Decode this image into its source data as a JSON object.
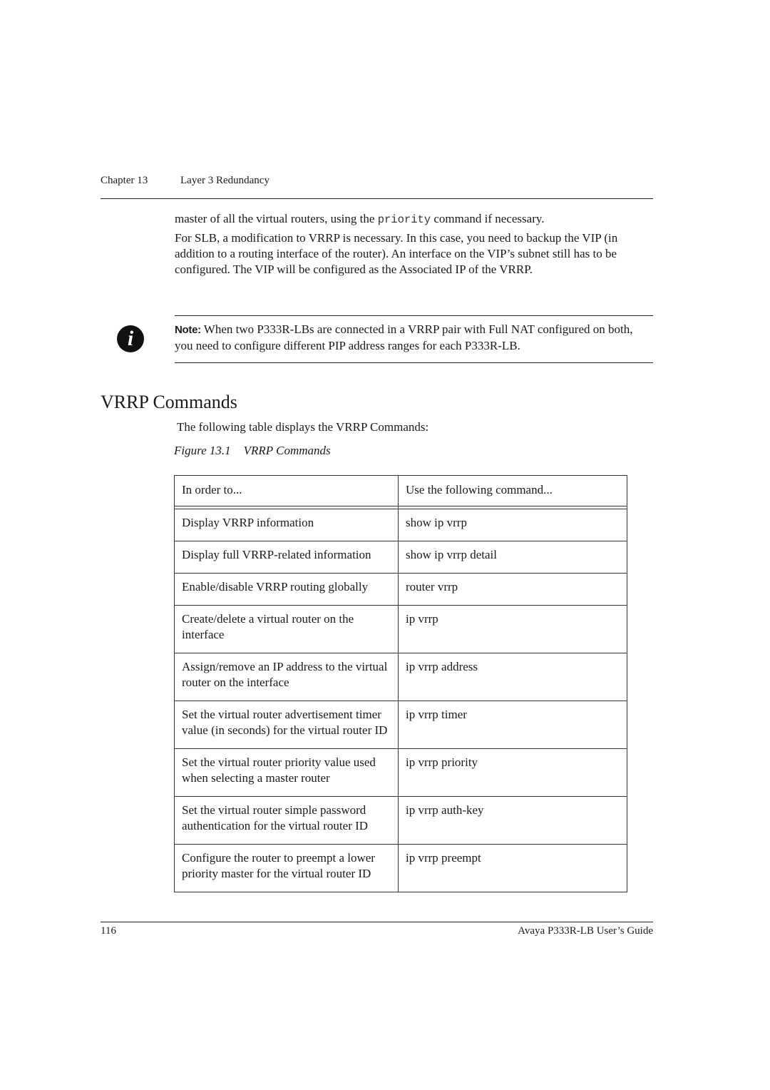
{
  "header": {
    "chapter": "Chapter 13",
    "title": "Layer 3 Redundancy"
  },
  "body": {
    "para1_before": "master of all the virtual routers, using the ",
    "para1_code": "priority",
    "para1_after": " command if necessary.",
    "para2": "For SLB, a modification to VRRP is necessary. In this case, you need to backup the VIP (in addition to a routing interface of the router). An interface on the VIP’s subnet still has to be configured. The VIP will be configured as the Associated IP of the VRRP."
  },
  "note": {
    "icon": "info-icon",
    "label": "Note:",
    "text": "When two P333R-LBs are connected in a VRRP pair with Full NAT configured on both, you need to configure different PIP address ranges for each P333R-LB."
  },
  "section": {
    "title": "VRRP Commands",
    "intro": "The following table displays the VRRP Commands:",
    "figure_number": "Figure 13.1",
    "figure_title": "VRRP Commands"
  },
  "table": {
    "headers": [
      "In order to...",
      "Use the following command..."
    ],
    "rows": [
      {
        "purpose": "Display VRRP information",
        "command": "show ip vrrp"
      },
      {
        "purpose": "Display full VRRP-related information",
        "command": "show ip vrrp detail"
      },
      {
        "purpose": "Enable/disable VRRP routing globally",
        "command": "router vrrp"
      },
      {
        "purpose": "Create/delete a virtual router on the interface",
        "command": "ip vrrp"
      },
      {
        "purpose": "Assign/remove an IP address to the virtual router on the interface",
        "command": "ip vrrp address"
      },
      {
        "purpose": "Set the virtual router advertisement timer value (in seconds) for the virtual router ID",
        "command": "ip vrrp timer"
      },
      {
        "purpose": "Set the virtual router priority value used when selecting a master router",
        "command": "ip vrrp priority"
      },
      {
        "purpose": "Set the virtual router simple password authentication for the virtual router ID",
        "command": "ip vrrp auth-key"
      },
      {
        "purpose": "Configure the router to preempt a lower priority master for the virtual router ID",
        "command": "ip vrrp preempt"
      }
    ]
  },
  "footer": {
    "page_number": "116",
    "guide_title": "Avaya P333R-LB User’s Guide"
  }
}
